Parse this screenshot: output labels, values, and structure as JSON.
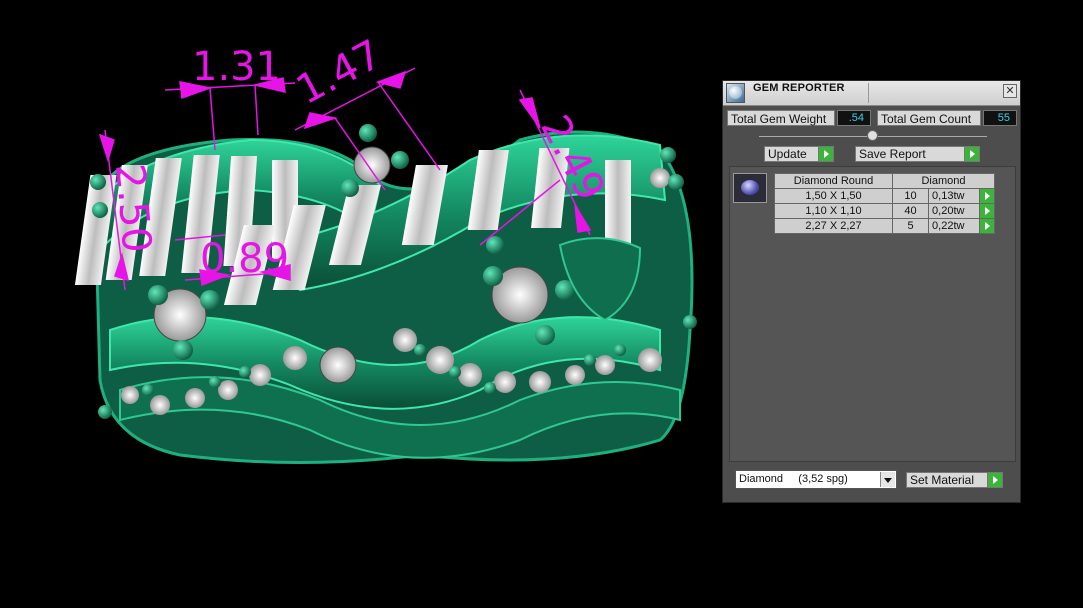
{
  "viewport": {
    "dimensions": [
      "1.31",
      "1.47",
      "2.49",
      "2.50",
      "0.89"
    ],
    "accent_color": "#e614e6",
    "model_color": "#1a8f6a"
  },
  "panel": {
    "title": "GEM REPORTER",
    "close_label": "✕",
    "total_gem_weight_label": "Total Gem Weight",
    "total_gem_weight_value": ".54",
    "total_gem_count_label": "Total Gem Count",
    "total_gem_count_value": "55",
    "update_label": "Update",
    "save_report_label": "Save Report",
    "table": {
      "headers": [
        "Diamond Round",
        "Diamond"
      ],
      "rows": [
        {
          "size": "1,50 X 1,50",
          "count": "10",
          "weight": "0,13tw"
        },
        {
          "size": "1,10 X 1,10",
          "count": "40",
          "weight": "0,20tw"
        },
        {
          "size": "2,27 X 2,27",
          "count": "5",
          "weight": "0,22tw"
        }
      ]
    },
    "material_select": "Diamond     (3,52 spg)",
    "set_material_label": "Set Material"
  }
}
